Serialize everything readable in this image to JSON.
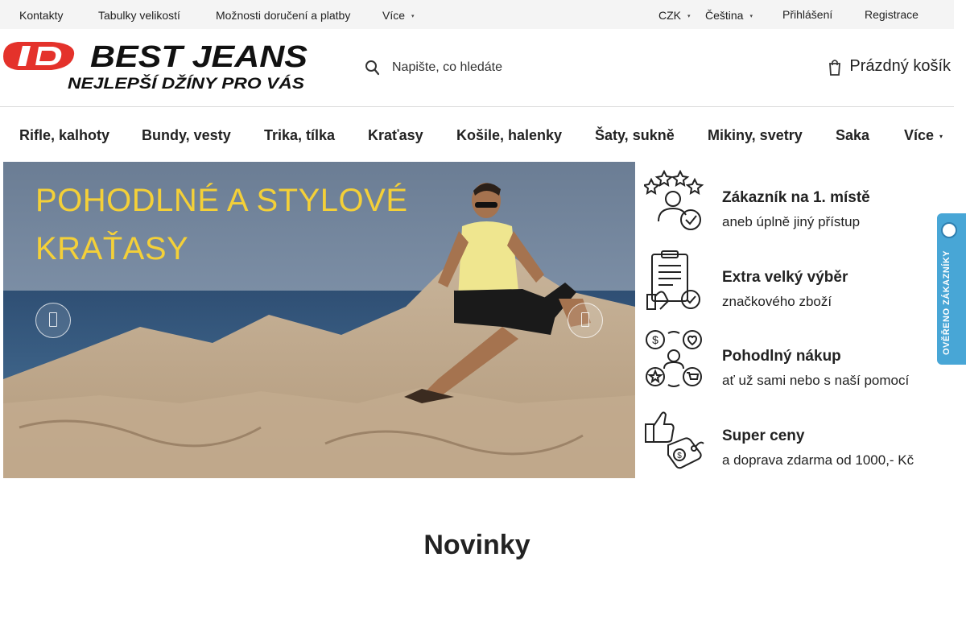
{
  "topbar": {
    "links": [
      {
        "label": "Kontakty",
        "has_caret": false
      },
      {
        "label": "Tabulky velikostí",
        "has_caret": false
      },
      {
        "label": "Možnosti doručení a platby",
        "has_caret": false
      },
      {
        "label": "Více",
        "has_caret": true
      }
    ],
    "currency": "CZK",
    "language": "Čeština",
    "login": "Přihlášení",
    "register": "Registrace"
  },
  "header": {
    "logo": {
      "brand": "BEST JEANS",
      "tagline": "NEJLEPŠÍ DŽÍNY PRO VÁS",
      "brand_color": "#e4322b"
    },
    "search_placeholder": "Napište, co hledáte",
    "search_icon": "search-icon",
    "cart_label": "Prázdný košík",
    "cart_icon": "cart-icon"
  },
  "nav": {
    "items": [
      "Rifle, kalhoty",
      "Bundy, vesty",
      "Trika, tílka",
      "Kraťasy",
      "Košile, halenky",
      "Šaty, sukně",
      "Mikiny, svetry",
      "Saka",
      "Více"
    ]
  },
  "hero": {
    "headline_line1": "POHODLNÉ A STYLOVÉ",
    "headline_line2": "KRAŤASY",
    "headline_color": "#f4d038",
    "prev_icon": "chevron-left-icon",
    "next_icon": "chevron-right-icon"
  },
  "benefits": [
    {
      "title": "Zákazník na 1. místě",
      "subtitle": "aneb úplně jiný přístup",
      "icon": "customer-rating-icon"
    },
    {
      "title": "Extra velký výběr",
      "subtitle": "značkového zboží",
      "icon": "clipboard-check-icon"
    },
    {
      "title": "Pohodlný nákup",
      "subtitle": "ať už sami nebo s naší pomocí",
      "icon": "shopping-support-icon"
    },
    {
      "title": "Super ceny",
      "subtitle": "a doprava zdarma od 1000,- Kč",
      "icon": "price-tag-icon"
    }
  ],
  "verified_badge": {
    "label": "OVĚŘENO ZÁKAZNÍKY",
    "color": "#48a6d6"
  },
  "section": {
    "title": "Novinky"
  }
}
